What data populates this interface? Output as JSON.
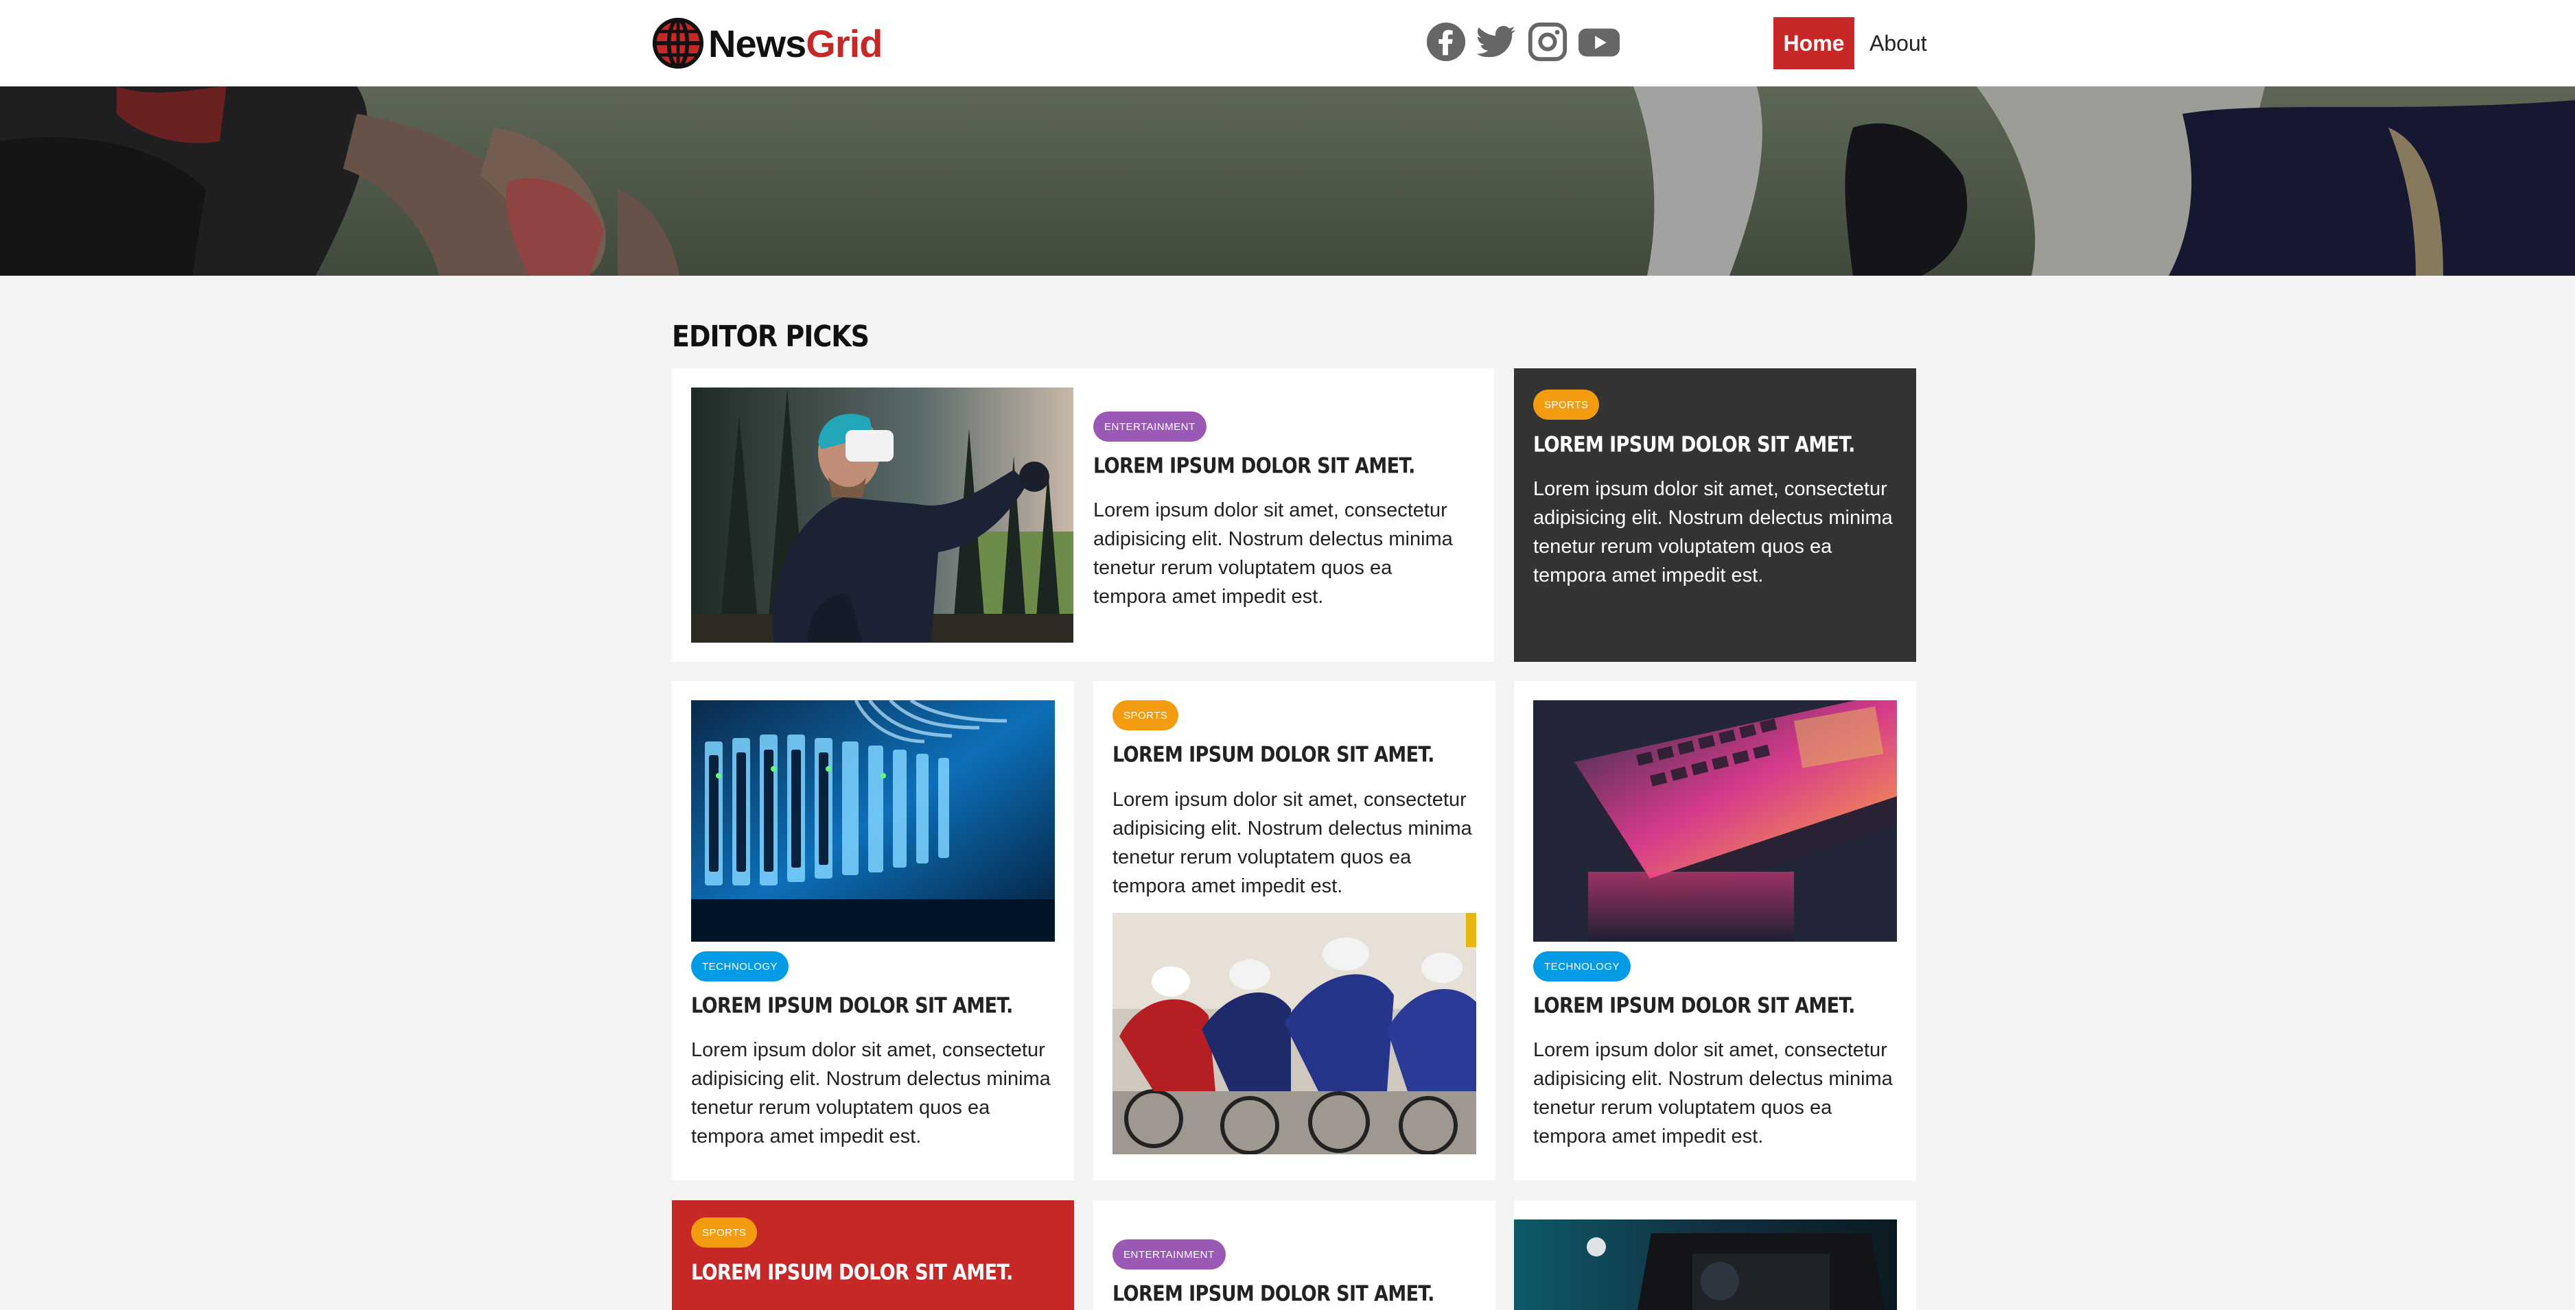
{
  "site": {
    "brand_part1": "News",
    "brand_part2": "Grid",
    "brand_accent": "#c62828"
  },
  "social_icons": [
    "facebook-icon",
    "twitter-icon",
    "instagram-icon",
    "youtube-icon"
  ],
  "nav": {
    "home_label": "Home",
    "about_label": "About",
    "active": "Home"
  },
  "section": {
    "title": "EDITOR PICKS"
  },
  "category_colors": {
    "ENTERTAINMENT": "#9b59b6",
    "SPORTS": "#f39c12",
    "TECHNOLOGY": "#039be5"
  },
  "cards": [
    {
      "category": "ENTERTAINMENT",
      "title": "LOREM IPSUM DOLOR SIT AMET.",
      "excerpt": "Lorem ipsum dolor sit amet, consectetur adipisicing elit. Nostrum delectus minima tenetur rerum voluptatem quos ea tempora amet impedit est.",
      "image": "man-with-vr-headset-in-forest"
    },
    {
      "category": "SPORTS",
      "title": "LOREM IPSUM DOLOR SIT AMET.",
      "excerpt": "Lorem ipsum dolor sit amet, consectetur adipisicing elit. Nostrum delectus minima tenetur rerum voluptatem quos ea tempora amet impedit est."
    },
    {
      "category": "TECHNOLOGY",
      "title": "LOREM IPSUM DOLOR SIT AMET.",
      "excerpt": "Lorem ipsum dolor sit amet, consectetur adipisicing elit. Nostrum delectus minima tenetur rerum voluptatem quos ea tempora amet impedit est.",
      "image": "server-rack-with-blue-lights"
    },
    {
      "category": "SPORTS",
      "title": "LOREM IPSUM DOLOR SIT AMET.",
      "excerpt": "Lorem ipsum dolor sit amet, consectetur adipisicing elit. Nostrum delectus minima tenetur rerum voluptatem quos ea tempora amet impedit est.",
      "image": "cyclists-racing"
    },
    {
      "category": "TECHNOLOGY",
      "title": "LOREM IPSUM DOLOR SIT AMET.",
      "excerpt": "Lorem ipsum dolor sit amet, consectetur adipisicing elit. Nostrum delectus minima tenetur rerum voluptatem quos ea tempora amet impedit est.",
      "image": "laptop-with-rgb-keyboard"
    },
    {
      "category": "SPORTS",
      "title": "LOREM IPSUM DOLOR SIT AMET."
    },
    {
      "category": "ENTERTAINMENT",
      "title": "LOREM IPSUM DOLOR SIT AMET."
    },
    {
      "image": "video-camera-in-studio"
    }
  ]
}
